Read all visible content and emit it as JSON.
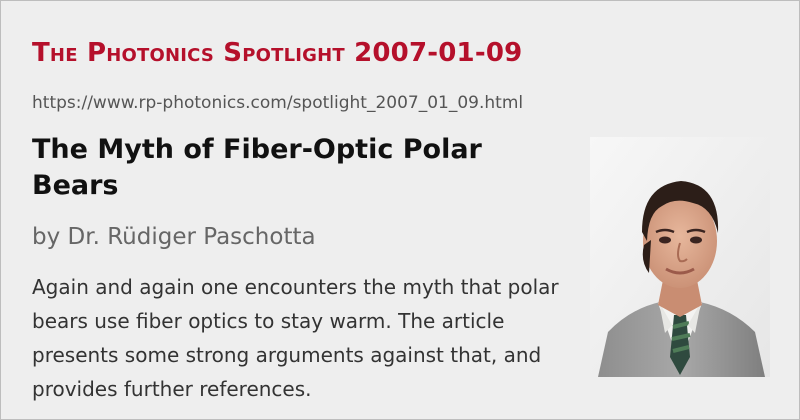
{
  "page": {
    "brand": "The Photonics Spotlight 2007-01-09",
    "url": "https://www.rp-photonics.com/spotlight_2007_01_09.html",
    "title": "The Myth of Fiber-Optic Polar Bears",
    "author": "by Dr. Rüdiger Paschotta",
    "summary": "Again and again one encounters the myth that polar bears use fiber optics to stay warm. The article presents some strong arguments against that, and provides further references."
  },
  "colors": {
    "brand": "#b5102b",
    "background": "#eeeeee",
    "url": "#555555",
    "author": "#666666"
  }
}
